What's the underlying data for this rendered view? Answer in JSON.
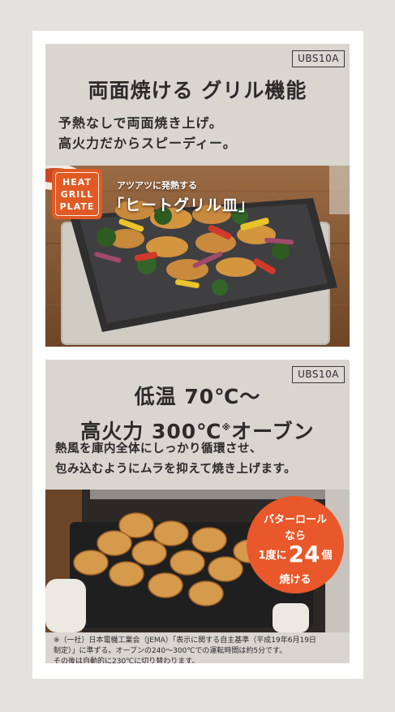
{
  "panel1": {
    "model": "UBS10A",
    "title": "両面焼ける グリル機能",
    "subtitle_line1": "予熱なしで両面焼き上げ。",
    "subtitle_line2": "高火力だからスピーディー。",
    "badge": {
      "line1": "HEAT",
      "line2": "GRILL",
      "line3": "PLATE"
    },
    "caption_small": "アツアツに発熱する",
    "caption_big": "「ヒートグリル皿」"
  },
  "panel2": {
    "model": "UBS10A",
    "title_line1": "低温 70℃～",
    "title_line2_a": "高火力 300℃",
    "title_line2_mark": "※",
    "title_line2_b": "オーブン",
    "desc_line1": "熱風を庫内全体にしっかり循環させ、",
    "desc_line2": "包み込むようにムラを抑えて焼き上げます。",
    "badge": {
      "line1": "バターロール",
      "line2": "なら",
      "line3_a": "1度に",
      "line3_num": "24",
      "line3_b": "個",
      "line4": "焼ける"
    },
    "footnote_line1": "※（一社）日本電機工業会（JEMA）「表示に関する自主基準（平成19年6月19日",
    "footnote_line2": "制定）」に準ずる。オーブンの240～300℃での運転時間は約5分です。",
    "footnote_line3": "その後は自動的に230℃に切り替わります。"
  },
  "colors": {
    "accent": "#e05a24",
    "card_bg": "#d9d6d0",
    "page_bg": "#e4e2dd"
  }
}
